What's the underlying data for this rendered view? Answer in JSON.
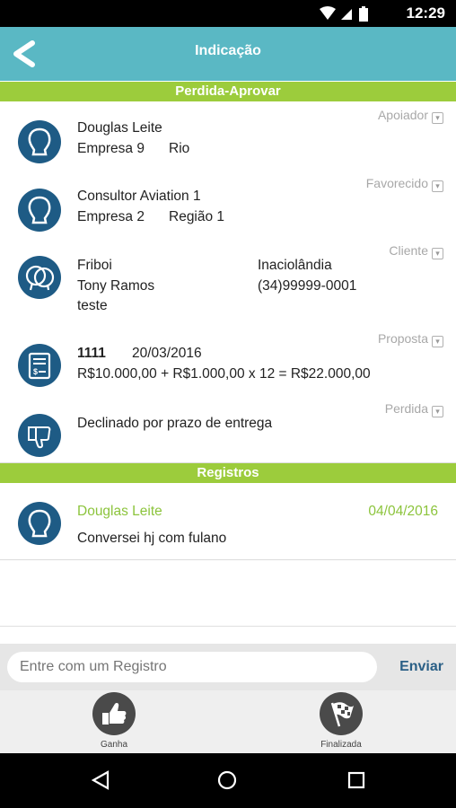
{
  "status": {
    "time": "12:29"
  },
  "header": {
    "title": "Indicação"
  },
  "sections": {
    "perdida": "Perdida-Aprovar",
    "registros": "Registros"
  },
  "apoiador": {
    "tag": "Apoiador",
    "name": "Douglas Leite",
    "company": "Empresa 9",
    "region": "Rio"
  },
  "favorecido": {
    "tag": "Favorecido",
    "name": "Consultor Aviation 1",
    "company": "Empresa 2",
    "region": "Região 1"
  },
  "cliente": {
    "tag": "Cliente",
    "name": "Friboi",
    "contact": "Tony Ramos",
    "note": "teste",
    "city": "Inaciolândia",
    "phone": "(34)99999-0001"
  },
  "proposta": {
    "tag": "Proposta",
    "number": "1111",
    "date": "20/03/2016",
    "formula": "R$10.000,00 + R$1.000,00 x 12 = R$22.000,00"
  },
  "perdida": {
    "tag": "Perdida",
    "reason": "Declinado por prazo de entrega"
  },
  "registro": {
    "author": "Douglas Leite",
    "date": "04/04/2016",
    "text": "Conversei hj com fulano"
  },
  "compose": {
    "placeholder": "Entre com um Registro",
    "send": "Enviar"
  },
  "actions": {
    "win": "Ganha",
    "finish": "Finalizada"
  },
  "colors": {
    "appbar": "#5ab8c4",
    "green": "#9ccc3c",
    "avatar": "#1e5b85",
    "registro_green": "#8cc43c"
  }
}
